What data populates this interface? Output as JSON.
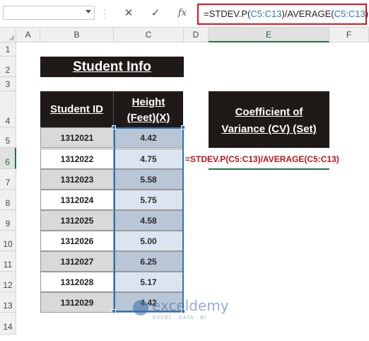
{
  "formula_bar": {
    "name_box": "",
    "cancel_icon": "✕",
    "enter_icon": "✓",
    "fx_label": "fx",
    "formula_prefix": "=STDEV.P(",
    "formula_ref1": "C5:C13",
    "formula_mid": ")/AVERAGE(",
    "formula_ref2": "C5:C13",
    "formula_suffix": ")"
  },
  "columns": [
    "A",
    "B",
    "C",
    "D",
    "E",
    "F"
  ],
  "rows": [
    "1",
    "2",
    "3",
    "4",
    "5",
    "6",
    "7",
    "8",
    "9",
    "10",
    "11",
    "12",
    "13",
    "14"
  ],
  "sheet": {
    "title": "Student Info",
    "header_id": "Student ID",
    "header_height_line1": "Height",
    "header_height_line2": "(Feet)(X)",
    "cv_header_line1": "Coefficient of",
    "cv_header_line2": "Variance (CV) (Set)",
    "cv_formula": "=STDEV.P(C5:C13)/AVERAGE(C5:C13)",
    "students": [
      {
        "id": "1312021",
        "height": "4.42"
      },
      {
        "id": "1312022",
        "height": "4.75"
      },
      {
        "id": "1312023",
        "height": "5.58"
      },
      {
        "id": "1312024",
        "height": "5.75"
      },
      {
        "id": "1312025",
        "height": "4.58"
      },
      {
        "id": "1312026",
        "height": "5.00"
      },
      {
        "id": "1312027",
        "height": "6.25"
      },
      {
        "id": "1312028",
        "height": "5.17"
      },
      {
        "id": "1312029",
        "height": "4.42"
      }
    ]
  },
  "watermark": {
    "name": "exceldemy",
    "tagline": "EXCEL · DATA · BI"
  },
  "colors": {
    "accent_green": "#217346",
    "ref_blue": "#2e75b6",
    "highlight_red": "#e0141d",
    "header_dark": "#1f1a17"
  }
}
